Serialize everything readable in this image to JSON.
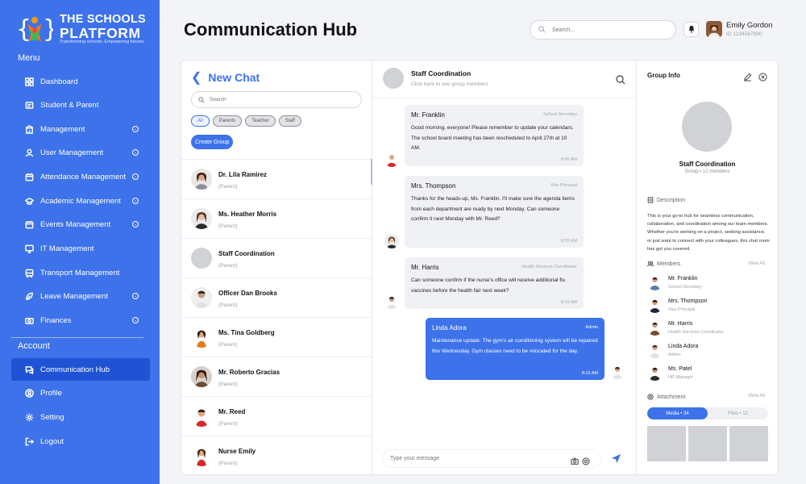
{
  "brand": {
    "line1": "THE SCHOOLS",
    "line2": "PLATFORM",
    "tagline": "Transforming schools. Empowering futures."
  },
  "sidebar": {
    "menu_heading": "Menu",
    "account_heading": "Account",
    "items": [
      {
        "label": "Dashboard",
        "icon": "grid-icon",
        "expandable": false
      },
      {
        "label": "Student & Parent",
        "icon": "student-icon",
        "expandable": false
      },
      {
        "label": "Management",
        "icon": "building-icon",
        "expandable": true
      },
      {
        "label": "User Management",
        "icon": "user-icon",
        "expandable": true
      },
      {
        "label": "Attendance Management",
        "icon": "calendar-icon",
        "expandable": true
      },
      {
        "label": "Academic Management",
        "icon": "graduation-cap-icon",
        "expandable": true
      },
      {
        "label": "Events Management",
        "icon": "calendar-icon",
        "expandable": true
      },
      {
        "label": "IT Management",
        "icon": "monitor-icon",
        "expandable": false
      },
      {
        "label": "Transport Management",
        "icon": "bus-icon",
        "expandable": false
      },
      {
        "label": "Leave Management",
        "icon": "leave-icon",
        "expandable": true
      },
      {
        "label": "Finances",
        "icon": "finance-icon",
        "expandable": true
      }
    ],
    "account_items": [
      {
        "label": "Communication Hub",
        "icon": "chat-icon",
        "active": true
      },
      {
        "label": "Profile",
        "icon": "profile-icon",
        "active": false
      },
      {
        "label": "Setting",
        "icon": "gear-icon",
        "active": false
      },
      {
        "label": "Logout",
        "icon": "logout-icon",
        "active": false
      }
    ]
  },
  "header": {
    "title": "Communication Hub",
    "search_placeholder": "Search...",
    "user_name": "Emily Gordon",
    "user_id": "ID 1234567890"
  },
  "chat_list": {
    "title": "New Chat",
    "search_placeholder": "Search",
    "filters": [
      {
        "label": "All",
        "active": true
      },
      {
        "label": "Parents",
        "active": false
      },
      {
        "label": "Teacher",
        "active": false
      },
      {
        "label": "Staff",
        "active": false
      }
    ],
    "create_group_label": "Create Group",
    "contacts": [
      {
        "name": "Dr. Lila Ramirez",
        "role": "(Parent)",
        "avatar": "photo"
      },
      {
        "name": "Ms. Heather Morris",
        "role": "(Parent)",
        "avatar": "photo"
      },
      {
        "name": "Staff Coordination",
        "role": "(Parent)",
        "avatar": "placeholder"
      },
      {
        "name": "Officer Dan Brooks",
        "role": "(Parent)",
        "avatar": "photo"
      },
      {
        "name": "Ms. Tina Goldberg",
        "role": "(Parent)",
        "avatar": "photo"
      },
      {
        "name": "Mr. Roberto Gracias",
        "role": "(Parent)",
        "avatar": "photo"
      },
      {
        "name": "Mr. Reed",
        "role": "(Parent)",
        "avatar": "photo"
      },
      {
        "name": "Nurse Emily",
        "role": "(Parent)",
        "avatar": "photo"
      }
    ]
  },
  "conversation": {
    "title": "Staff Coordination",
    "subtitle": "Click here to see group members",
    "messages": [
      {
        "sender": "Mr. Franklin",
        "role": "School Secretary",
        "text": "Good morning, everyone! Please remember to update your calendars. The school board meeting has been rescheduled to April 27th at 10 AM.",
        "time": "8:00 AM",
        "outgoing": false
      },
      {
        "sender": "Mrs. Thompson",
        "role": "Vice Principal",
        "text": "Thanks for the heads-up, Ms. Franklin. I'll make sure the agenda items from each department are ready by next Monday. Can someone confirm it next Monday with Mr. Reed?",
        "time": "8:05 AM",
        "outgoing": false
      },
      {
        "sender": "Mr. Harris",
        "role": "Health Services Coordinator",
        "text": "Can someone confirm if the nurse's office will receive additional flu vaccines before the health fair next week?",
        "time": "8:10 AM",
        "outgoing": false
      },
      {
        "sender": "Linda Adora",
        "role": "Admin",
        "text": "Maintenance update: The gym's air conditioning system will be repaired this Wednesday. Gym classes need to be relocated for the day.",
        "time": "8:15 AM",
        "outgoing": true
      }
    ],
    "composer_placeholder": "Type your message"
  },
  "group_info": {
    "title": "Group Info",
    "name": "Staff Coordination",
    "meta": "Group  •  12 members",
    "description_label": "Description",
    "description": "This is your go-to hub for seamless communication, collaboration, and coordination among our team members. Whether you're working on a project, seeking assistance, or just want to connect with your colleagues, this chat room has got you covered.",
    "members_label": "Members",
    "view_all": "View All",
    "members": [
      {
        "name": "Mr. Franklin",
        "role": "School Secretary"
      },
      {
        "name": "Mrs. Thompson",
        "role": "Vice Principal"
      },
      {
        "name": "Mr. Harris",
        "role": "Health Services Coordinator"
      },
      {
        "name": "Linda Adora",
        "role": "Admin"
      },
      {
        "name": "Ms. Patel",
        "role": "HR Manager"
      }
    ],
    "attachment_label": "Attachment",
    "tabs": [
      {
        "label": "Media • 34",
        "active": true
      },
      {
        "label": "Files • 12",
        "active": false
      }
    ]
  },
  "colors": {
    "accent": "#3d72ea",
    "sidebar": "#3d72ea",
    "sidebar_active": "#1f53d4"
  }
}
